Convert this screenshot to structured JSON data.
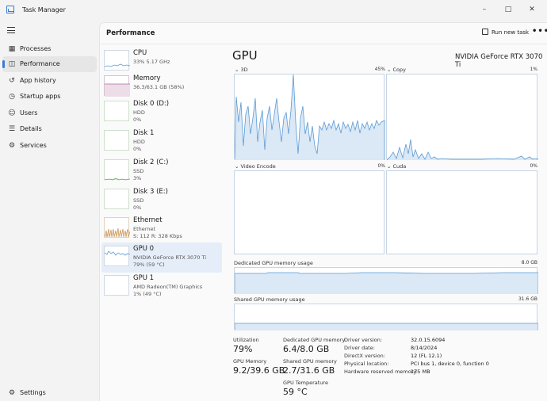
{
  "window": {
    "title": "Task Manager",
    "minimize": "–",
    "maximize": "□",
    "close": "✕"
  },
  "nav": {
    "items": [
      {
        "label": "Processes",
        "icon": "processes-icon",
        "glyph": "▦"
      },
      {
        "label": "Performance",
        "icon": "performance-icon",
        "glyph": "◫"
      },
      {
        "label": "App history",
        "icon": "history-icon",
        "glyph": "↺"
      },
      {
        "label": "Startup apps",
        "icon": "startup-icon",
        "glyph": "◷"
      },
      {
        "label": "Users",
        "icon": "users-icon",
        "glyph": "☺"
      },
      {
        "label": "Details",
        "icon": "details-icon",
        "glyph": "☰"
      },
      {
        "label": "Services",
        "icon": "services-icon",
        "glyph": "⚙"
      }
    ],
    "settings": {
      "label": "Settings",
      "glyph": "⚙"
    }
  },
  "header": {
    "title": "Performance",
    "run_task": "Run new task",
    "more": "•••"
  },
  "devices": [
    {
      "name": "CPU",
      "sub1": "33% 5.17 GHz",
      "sub2": ""
    },
    {
      "name": "Memory",
      "sub1": "36.3/63.1 GB (58%)",
      "sub2": ""
    },
    {
      "name": "Disk 0 (D:)",
      "sub1": "HDD",
      "sub2": "0%"
    },
    {
      "name": "Disk 1",
      "sub1": "HDD",
      "sub2": "0%"
    },
    {
      "name": "Disk 2 (C:)",
      "sub1": "SSD",
      "sub2": "3%"
    },
    {
      "name": "Disk 3 (E:)",
      "sub1": "SSD",
      "sub2": "0%"
    },
    {
      "name": "Ethernet",
      "sub1": "Ethernet",
      "sub2": "S: 112 R: 328 Kbps"
    },
    {
      "name": "GPU 0",
      "sub1": "NVIDIA GeForce RTX 3070 Ti",
      "sub2": "79% (59 °C)"
    },
    {
      "name": "GPU 1",
      "sub1": "AMD Radeon(TM) Graphics",
      "sub2": "1% (49 °C)"
    }
  ],
  "gpu": {
    "title": "GPU",
    "model": "NVIDIA GeForce RTX 3070 Ti",
    "engines": [
      {
        "label": "3D",
        "pct": "45%"
      },
      {
        "label": "Copy",
        "pct": "1%"
      },
      {
        "label": "Video Encode",
        "pct": "0%"
      },
      {
        "label": "Cuda",
        "pct": "0%"
      }
    ],
    "dedicated_label": "Dedicated GPU memory usage",
    "dedicated_max": "8.0 GB",
    "shared_label": "Shared GPU memory usage",
    "shared_max": "31.6 GB",
    "stats": {
      "utilization_label": "Utilization",
      "utilization": "79%",
      "dedicated_label": "Dedicated GPU memory",
      "dedicated": "6.4/8.0 GB",
      "gpu_memory_label": "GPU Memory",
      "gpu_memory": "9.2/39.6 GB",
      "shared_label": "Shared GPU memory",
      "shared": "2.7/31.6 GB",
      "temp_label": "GPU Temperature",
      "temp": "59 °C"
    },
    "info": [
      {
        "key": "Driver version:",
        "value": "32.0.15.6094"
      },
      {
        "key": "Driver date:",
        "value": "8/14/2024"
      },
      {
        "key": "DirectX version:",
        "value": "12 (FL 12.1)"
      },
      {
        "key": "Physical location:",
        "value": "PCI bus 1, device 0, function 0"
      },
      {
        "key": "Hardware reserved memory:",
        "value": "175 MB"
      }
    ]
  },
  "colors": {
    "accent": "#3a7bd5",
    "graph_line": "#5b9bd5",
    "graph_fill": "#dbe8f5",
    "memory_line": "#b06aa0"
  }
}
